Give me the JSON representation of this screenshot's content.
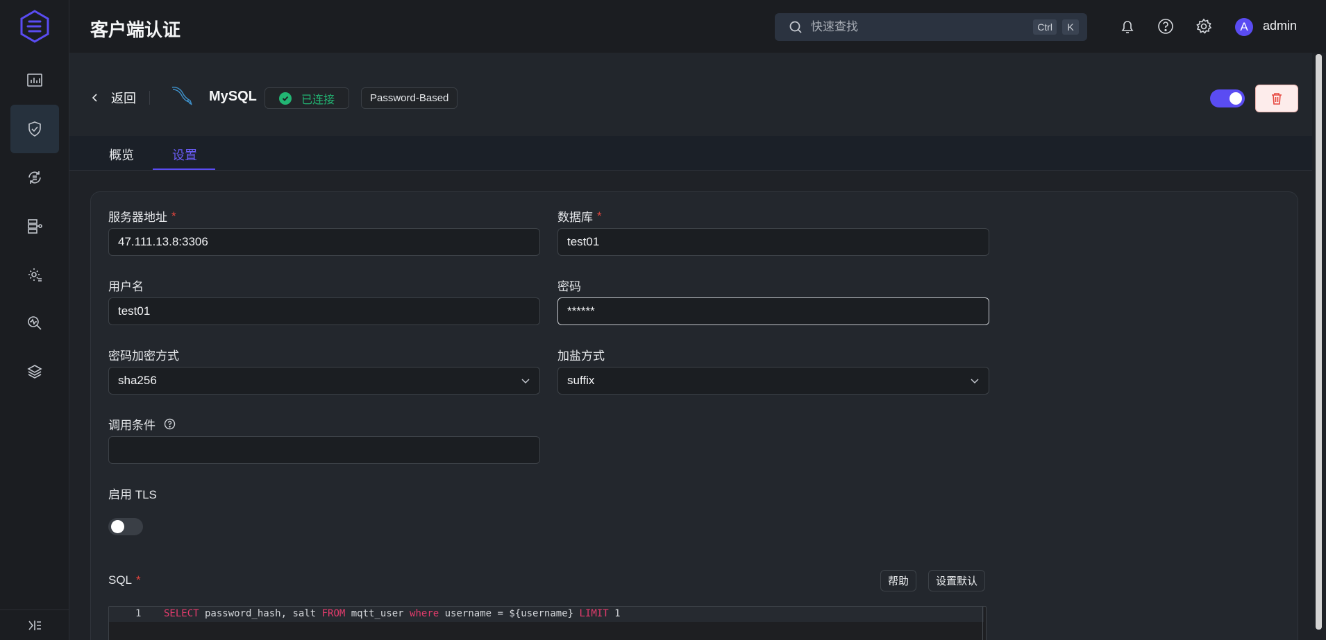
{
  "header": {
    "title": "客户端认证",
    "search_placeholder": "快速查找",
    "shortcut_keys": [
      "Ctrl",
      "K"
    ],
    "username": "admin",
    "avatar_initial": "A"
  },
  "topbar": {
    "back_label": "返回",
    "db_name": "MySQL",
    "status": "已连接",
    "mechanism": "Password-Based"
  },
  "tabs": [
    {
      "label": "概览"
    },
    {
      "label": "设置"
    }
  ],
  "form": {
    "server": {
      "label": "服务器地址",
      "value": "47.111.13.8:3306"
    },
    "database": {
      "label": "数据库",
      "value": "test01"
    },
    "username": {
      "label": "用户名",
      "value": "test01"
    },
    "password": {
      "label": "密码",
      "value": "******"
    },
    "hash": {
      "label": "密码加密方式",
      "value": "sha256"
    },
    "salt": {
      "label": "加盐方式",
      "value": "suffix"
    },
    "condition": {
      "label": "调用条件",
      "value": ""
    },
    "tls": {
      "label": "启用 TLS"
    },
    "sql": {
      "label": "SQL",
      "help_button": "帮助",
      "default_button": "设置默认",
      "line_number": "1"
    }
  },
  "sql_tokens": {
    "t1": "SELECT",
    "t2": " password_hash, salt ",
    "t3": "FROM",
    "t4": " mqtt_user ",
    "t5": "where",
    "t6": " username = ${username} ",
    "t7": "LIMIT",
    "t8": " 1"
  },
  "colors": {
    "accent": "#5a4cf2",
    "success": "#22b573",
    "danger": "#e6453d",
    "sql_keyword": "#e53c6d"
  }
}
